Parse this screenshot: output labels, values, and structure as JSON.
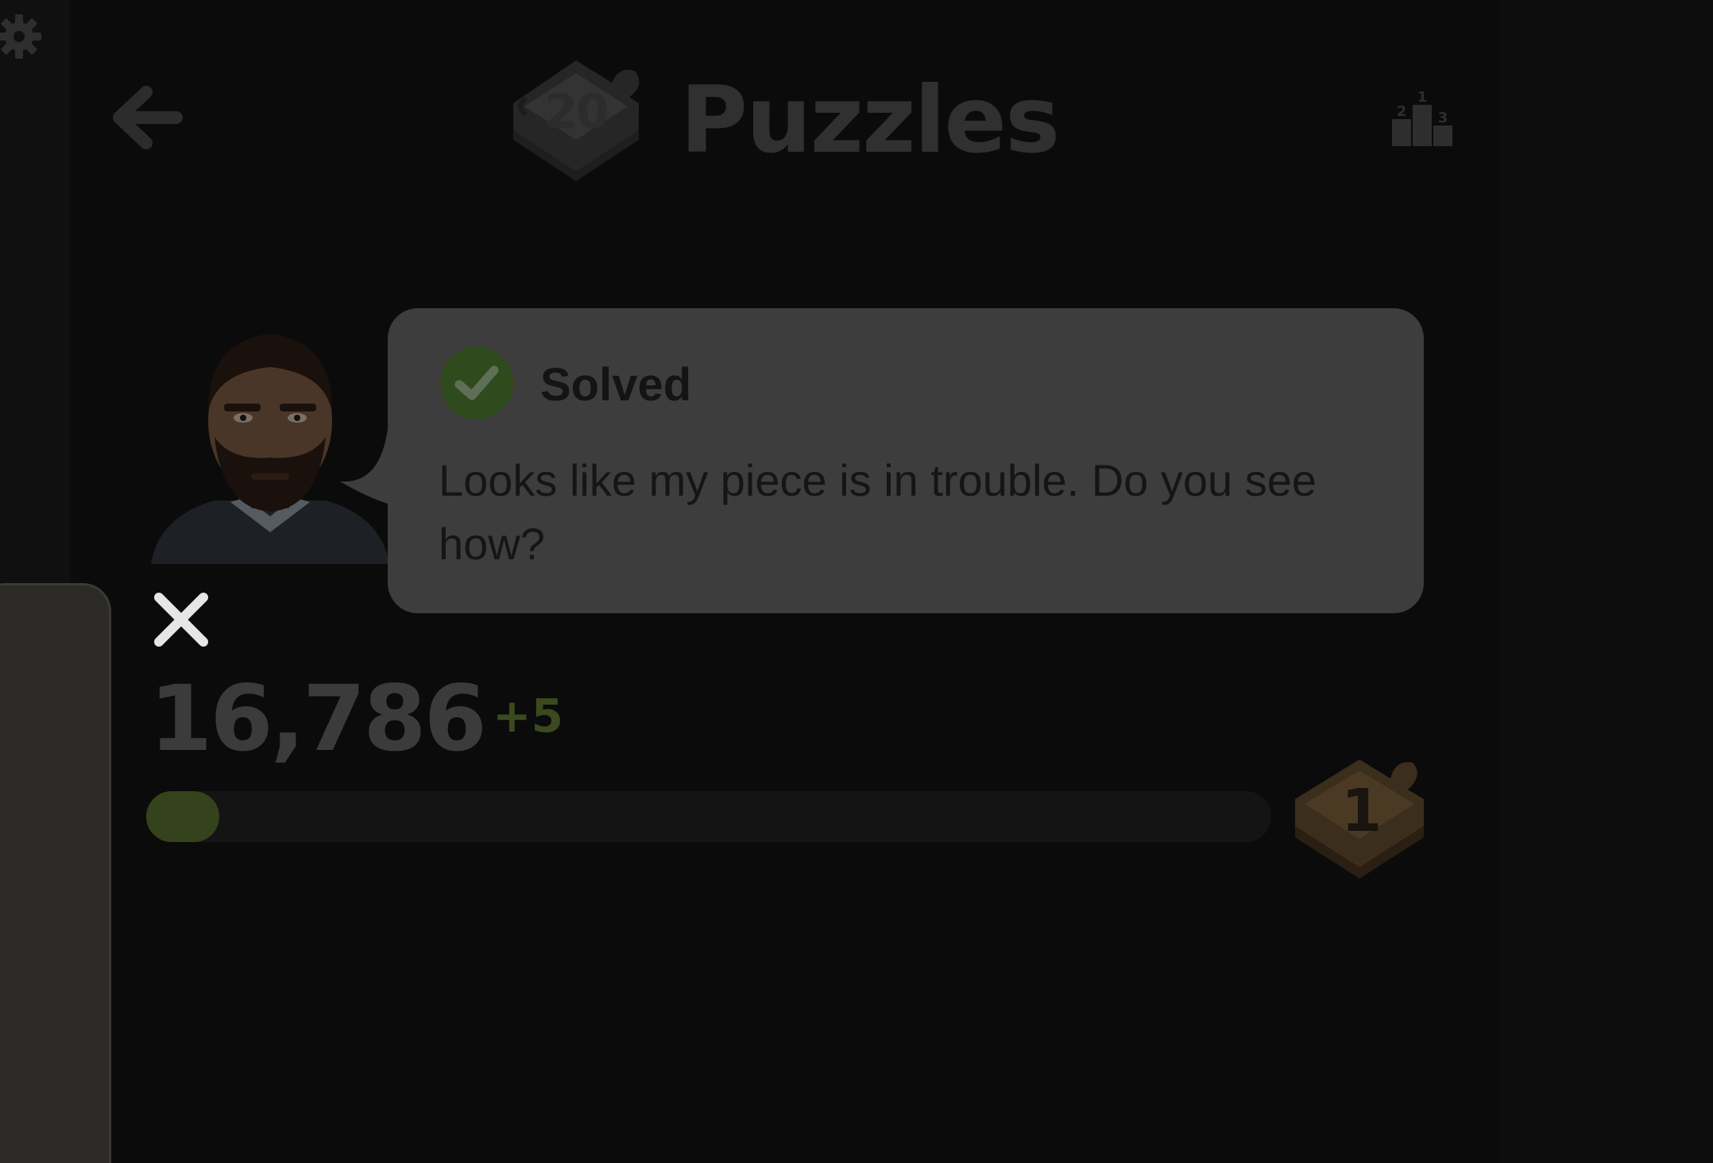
{
  "header": {
    "title": "Puzzles",
    "streak_badge": "20",
    "back_icon": "arrow-left-icon",
    "leaderboard_icon": "podium-icon",
    "leaderboard_ranks": [
      "2",
      "1",
      "3"
    ]
  },
  "coach": {
    "status": "Solved",
    "message": "Looks like my piece is in trouble. Do you see how?",
    "status_color": "#2f4a1c"
  },
  "rating": {
    "value": "16,786",
    "change": "+5",
    "progress_fraction": 0.065,
    "level": "1"
  },
  "colors": {
    "accent_green": "#34431c",
    "bubble_bg": "#3d3d3d",
    "background": "#0b0b0b"
  }
}
